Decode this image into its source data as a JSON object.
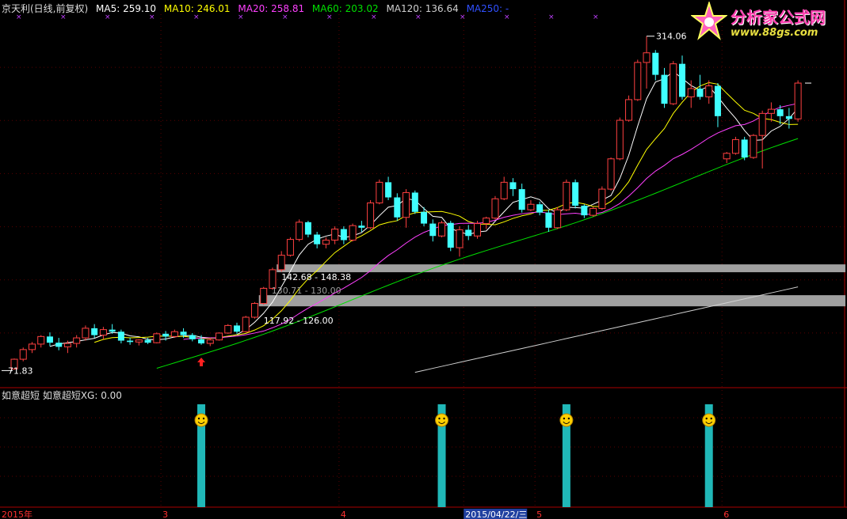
{
  "header": {
    "title": "京天利(日线,前复权)",
    "ma": [
      {
        "label": "MA5: 259.10",
        "color": "#ffffff"
      },
      {
        "label": "MA10: 246.01",
        "color": "#ffff00"
      },
      {
        "label": "MA20: 258.81",
        "color": "#ff40ff"
      },
      {
        "label": "MA60: 203.02",
        "color": "#00e000"
      },
      {
        "label": "MA120: 136.64",
        "color": "#d0d0d0"
      },
      {
        "label": "MA250: -",
        "color": "#3050ff"
      }
    ]
  },
  "logo": {
    "line1": "分析家公式网",
    "line2": "www.88gs.com"
  },
  "indicator": {
    "label": "如意超短  如意超短XG: 0.00"
  },
  "chart_data": {
    "type": "candlestick",
    "period": "daily",
    "ylim": [
      60,
      330
    ],
    "high_label": "314.06",
    "low_label": "71.83",
    "candles": [
      [
        72.5,
        80.0,
        71.83,
        79.5
      ],
      [
        79.5,
        88.0,
        78.0,
        86.5
      ],
      [
        86.5,
        92.0,
        84.0,
        90.5
      ],
      [
        90.5,
        97.0,
        88.0,
        96.0
      ],
      [
        96.0,
        99.0,
        89.0,
        91.5
      ],
      [
        91.5,
        95.0,
        86.0,
        88.5
      ],
      [
        88.5,
        93.0,
        84.0,
        91.0
      ],
      [
        91.0,
        97.0,
        88.0,
        95.0
      ],
      [
        95.0,
        104.0,
        93.0,
        102.0
      ],
      [
        102.0,
        105.0,
        95.0,
        97.0
      ],
      [
        97.0,
        103.0,
        94.0,
        101.0
      ],
      [
        101.0,
        105.0,
        98.0,
        99.5
      ],
      [
        99.5,
        101.0,
        91.0,
        93.0
      ],
      [
        93.0,
        95.0,
        90.0,
        92.0
      ],
      [
        92.0,
        94.0,
        89.5,
        93.5
      ],
      [
        93.5,
        95.0,
        90.5,
        91.5
      ],
      [
        91.5,
        99.0,
        91.0,
        98.0
      ],
      [
        98.0,
        100.0,
        93.0,
        96.0
      ],
      [
        96.0,
        101.0,
        95.0,
        99.5
      ],
      [
        99.5,
        102.0,
        95.0,
        97.0
      ],
      [
        97.0,
        98.5,
        92.5,
        94.0
      ],
      [
        94.0,
        97.0,
        90.0,
        91.0
      ],
      [
        91.0,
        95.0,
        89.0,
        93.5
      ],
      [
        93.5,
        99.0,
        93.0,
        98.5
      ],
      [
        98.5,
        105.0,
        98.0,
        104.0
      ],
      [
        104.0,
        106.0,
        98.0,
        99.5
      ],
      [
        99.5,
        111.0,
        99.0,
        110.0
      ],
      [
        110.0,
        121.0,
        109.0,
        120.0
      ],
      [
        120.0,
        132.0,
        119.0,
        131.0
      ],
      [
        131.0,
        146.0,
        130.0,
        144.5
      ],
      [
        144.5,
        158.0,
        143.0,
        155.0
      ],
      [
        155.0,
        168.0,
        154.0,
        166.5
      ],
      [
        166.5,
        181.0,
        165.0,
        179.0
      ],
      [
        179.0,
        180.0,
        168.0,
        170.0
      ],
      [
        170.0,
        172.0,
        160.0,
        163.0
      ],
      [
        163.0,
        168.0,
        160.0,
        166.0
      ],
      [
        166.0,
        176.0,
        163.0,
        174.0
      ],
      [
        174.0,
        176.0,
        163.0,
        166.0
      ],
      [
        166.0,
        178.0,
        165.0,
        176.5
      ],
      [
        176.5,
        180.0,
        172.0,
        175.0
      ],
      [
        175.0,
        195.0,
        174.0,
        193.0
      ],
      [
        193.0,
        210.0,
        192.0,
        208.0
      ],
      [
        208.0,
        212.0,
        195.0,
        197.0
      ],
      [
        197.0,
        200.0,
        180.0,
        182.5
      ],
      [
        182.5,
        203.0,
        175.0,
        200.5
      ],
      [
        200.5,
        202.0,
        185.0,
        186.5
      ],
      [
        186.5,
        190.0,
        176.0,
        178.0
      ],
      [
        178.0,
        181.0,
        165.0,
        169.0
      ],
      [
        169.0,
        180.0,
        168.0,
        178.5
      ],
      [
        178.5,
        180.0,
        158.0,
        160.5
      ],
      [
        160.5,
        176.0,
        154.0,
        173.5
      ],
      [
        173.5,
        177.0,
        166.0,
        169.0
      ],
      [
        169.0,
        180.0,
        167.0,
        178.0
      ],
      [
        178.0,
        183.0,
        174.0,
        182.0
      ],
      [
        182.0,
        198.0,
        181.0,
        196.0
      ],
      [
        196.0,
        212.0,
        195.0,
        208.0
      ],
      [
        208.0,
        211.0,
        198.0,
        203.0
      ],
      [
        203.0,
        207.0,
        186.0,
        188.0
      ],
      [
        188.0,
        195.0,
        187.0,
        192.0
      ],
      [
        192.0,
        194.0,
        184.0,
        186.0
      ],
      [
        186.0,
        188.0,
        172.0,
        175.0
      ],
      [
        175.0,
        190.0,
        174.0,
        188.0
      ],
      [
        188.0,
        210.0,
        187.0,
        208.0
      ],
      [
        208.0,
        210.0,
        189.0,
        191.0
      ],
      [
        191.0,
        192.0,
        182.0,
        184.0
      ],
      [
        184.0,
        190.0,
        183.0,
        189.0
      ],
      [
        189.0,
        205.0,
        188.0,
        203.0
      ],
      [
        203.0,
        226.0,
        202.0,
        225.0
      ],
      [
        225.0,
        255.0,
        224.0,
        253.0
      ],
      [
        253.0,
        271.0,
        252.0,
        268.0
      ],
      [
        268.0,
        297.0,
        267.0,
        295.0
      ],
      [
        295.0,
        314.06,
        276.0,
        302.0
      ],
      [
        302.0,
        304.0,
        282.0,
        286.0
      ],
      [
        286.0,
        291.0,
        262.0,
        265.0
      ],
      [
        265.0,
        296.0,
        264.0,
        294.0
      ],
      [
        294.0,
        300.0,
        268.0,
        270.0
      ],
      [
        270.0,
        282.0,
        262.0,
        276.0
      ],
      [
        276.0,
        286.0,
        268.0,
        270.0
      ],
      [
        270.0,
        282.0,
        265.0,
        278.0
      ],
      [
        278.0,
        280.0,
        248.0,
        256.0
      ],
      [
        225.0,
        230.0,
        222.0,
        229.0
      ],
      [
        229.0,
        241.0,
        228.0,
        239.0
      ],
      [
        239.0,
        241.0,
        224.0,
        226.0
      ],
      [
        226.0,
        243.0,
        225.0,
        242.0
      ],
      [
        242.0,
        260.0,
        218.0,
        258.0
      ],
      [
        258.0,
        266.0,
        252.0,
        261.0
      ],
      [
        261.0,
        264.0,
        250.0,
        256.0
      ],
      [
        256.0,
        262.0,
        247.0,
        254.0
      ],
      [
        254.0,
        282.0,
        252.0,
        280.0
      ]
    ],
    "ma_series": [
      {
        "name": "MA5",
        "color": "#ffffff"
      },
      {
        "name": "MA10",
        "color": "#ffff00"
      },
      {
        "name": "MA20",
        "color": "#ff40ff"
      },
      {
        "name": "MA60",
        "color": "#00e000"
      },
      {
        "name": "MA120",
        "color": "#d0d0d0"
      }
    ],
    "zones": [
      {
        "label": "142.68 - 148.38",
        "low": 142.68,
        "high": 148.38
      },
      {
        "label": "117.92 - 126.00",
        "low": 117.92,
        "high": 126.0
      }
    ],
    "hidden_label": "130.71 - 130.00",
    "signals_index": [
      21,
      48,
      62,
      78
    ],
    "xticks": [
      {
        "label": "2015年",
        "index": 0
      },
      {
        "label": "3",
        "index": 17
      },
      {
        "label": "4",
        "index": 37
      },
      {
        "label": "2015/04/22/三",
        "index": 51,
        "highlight": true
      },
      {
        "label": "5",
        "index": 59
      },
      {
        "label": "6",
        "index": 80
      }
    ],
    "grid": true,
    "colors": {
      "up": "#ff4040",
      "down": "#40ffff",
      "bg": "#000000",
      "frame": "#aa0000"
    }
  }
}
